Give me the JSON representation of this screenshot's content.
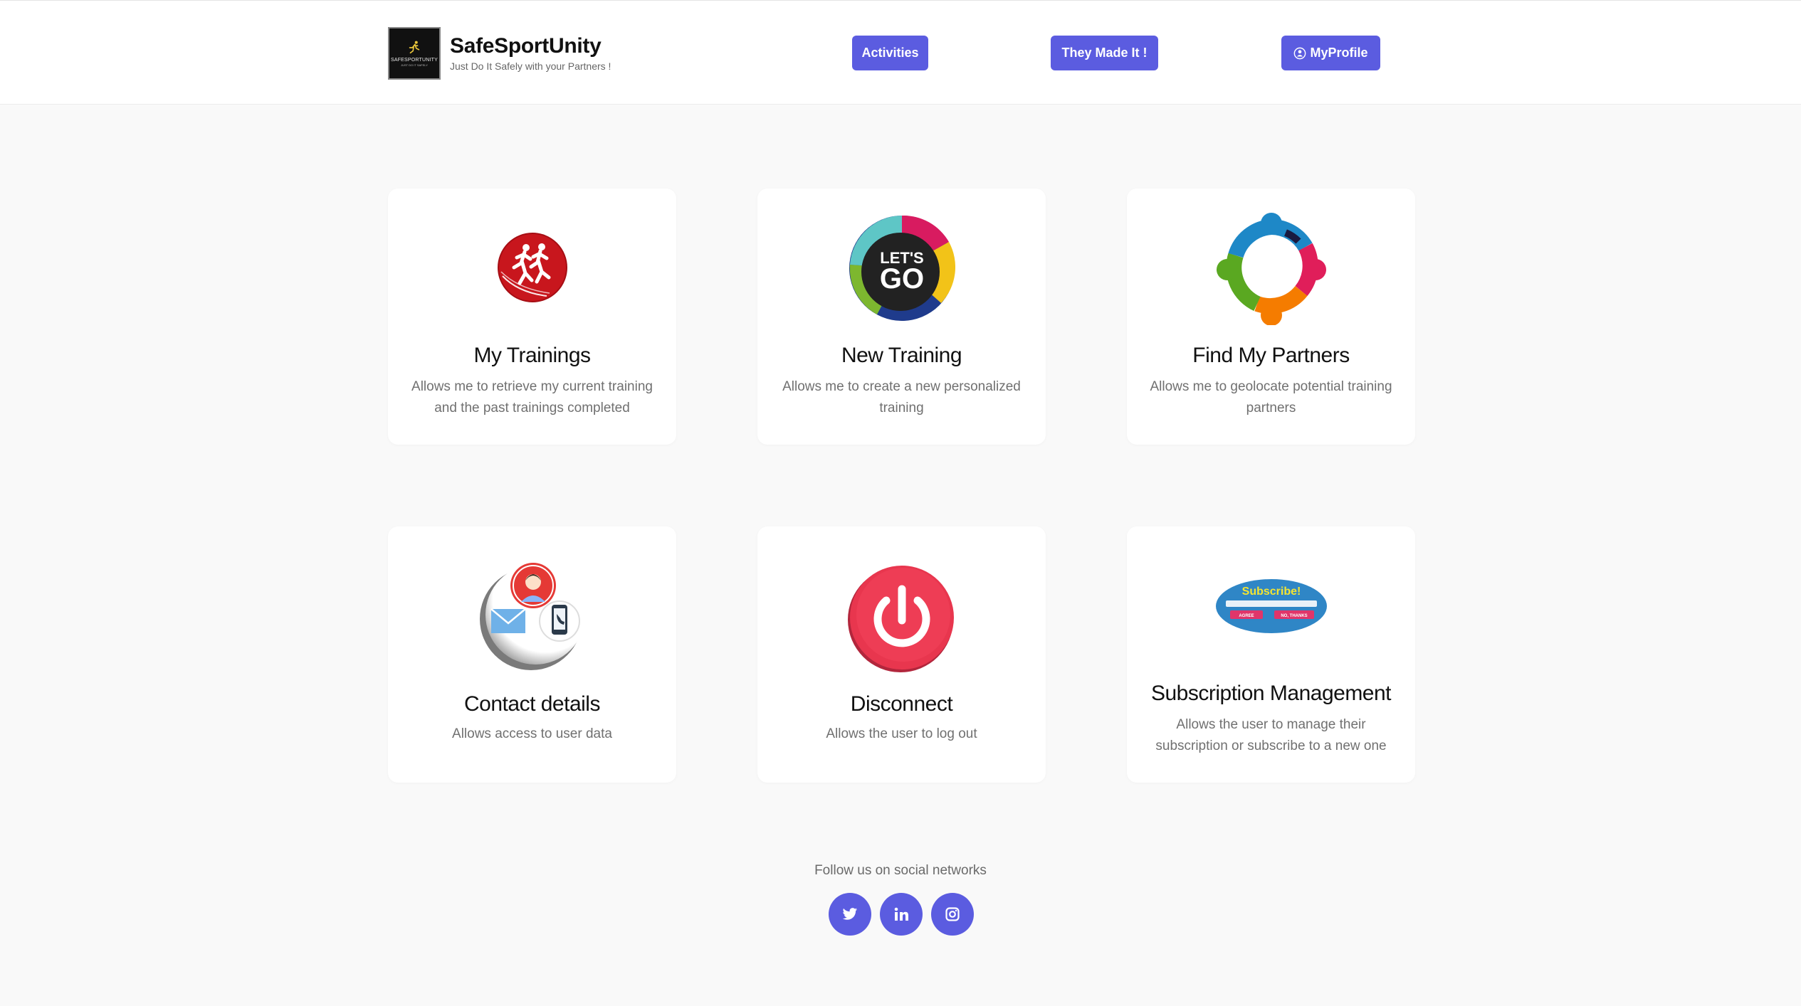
{
  "header": {
    "logo_text": "SAFESPORTUNITY",
    "logo_subtext": "JUST DO IT SAFELY",
    "brand_name": "SafeSportUnity",
    "tagline": "Just Do It Safely with your Partners !",
    "nav": {
      "activities": "Activities",
      "they_made_it": "They Made It !",
      "my_profile": "MyProfile"
    },
    "accent_color": "#5b5ce0"
  },
  "cards": [
    {
      "title": "My Trainings",
      "description": "Allows me to retrieve my current training and the past trainings completed",
      "icon": "runners-icon"
    },
    {
      "title": "New Training",
      "description": "Allows me to create a new personalized training",
      "icon": "lets-go-icon",
      "icon_text_top": "LET'S",
      "icon_text_bottom": "GO"
    },
    {
      "title": "Find My Partners",
      "description": "Allows me to geolocate potential training partners",
      "icon": "team-circle-icon"
    },
    {
      "title": "Contact details",
      "description": "Allows access to user data",
      "icon": "contact-icon"
    },
    {
      "title": "Disconnect",
      "description": "Allows the user to log out",
      "icon": "power-icon"
    },
    {
      "title": "Subscription Management",
      "description": "Allows the user to manage their subscription or subscribe to a new one",
      "icon": "subscribe-icon",
      "icon_heading": "Subscribe!",
      "icon_agree": "AGREE",
      "icon_decline": "NO, THANKS"
    }
  ],
  "footer": {
    "follow_text": "Follow us on social networks",
    "social": [
      "twitter-icon",
      "linkedin-icon",
      "instagram-icon"
    ]
  }
}
